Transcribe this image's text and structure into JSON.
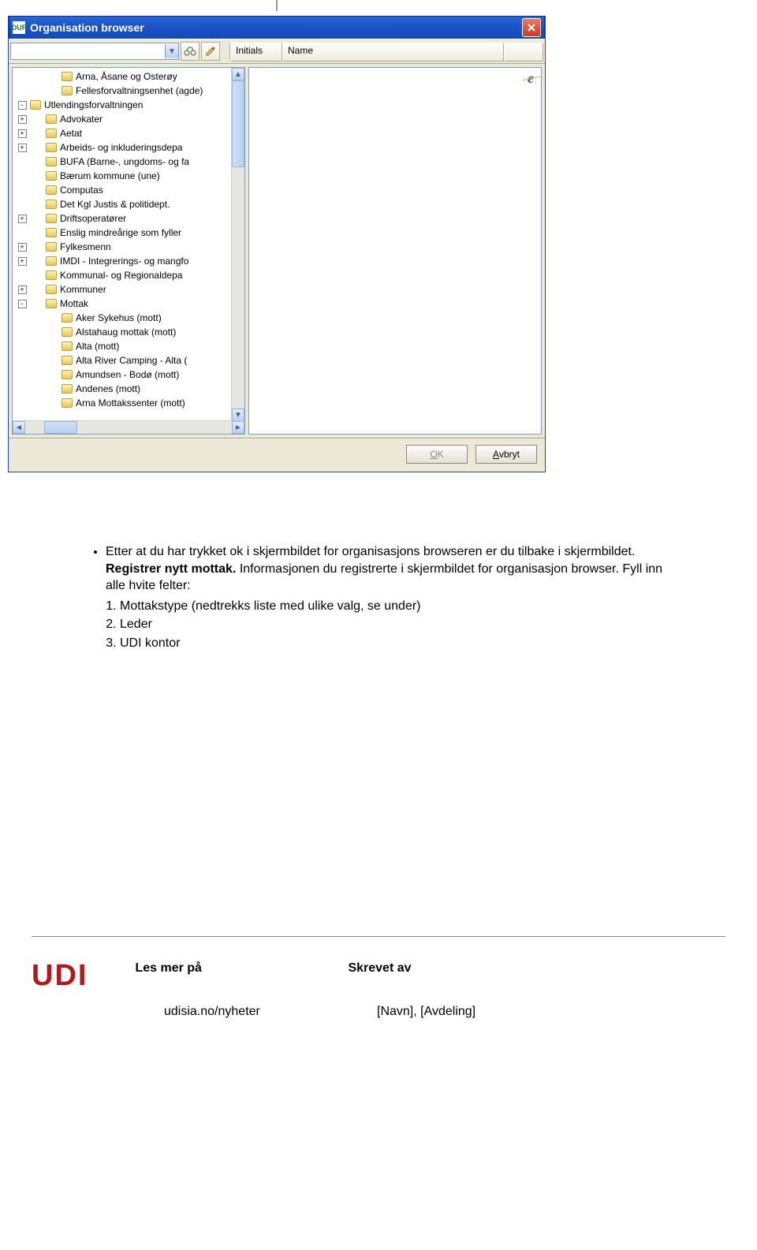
{
  "window": {
    "title": "Organisation browser",
    "app_icon_text": "DUF",
    "columns": {
      "initials": "Initials",
      "name": "Name"
    },
    "buttons": {
      "ok_letter": "O",
      "ok_rest": "K",
      "cancel_letter": "A",
      "cancel_rest": "vbryt"
    },
    "tree": [
      {
        "indent": 2,
        "pm": "",
        "label": "Arna, Åsane og Osterøy"
      },
      {
        "indent": 2,
        "pm": "",
        "label": "Fellesforvaltningsenhet (agde)"
      },
      {
        "indent": 0,
        "pm": "-",
        "label": "Utlendingsforvaltningen"
      },
      {
        "indent": 1,
        "pm": "+",
        "label": "Advokater"
      },
      {
        "indent": 1,
        "pm": "+",
        "label": "Aetat"
      },
      {
        "indent": 1,
        "pm": "+",
        "label": "Arbeids- og inkluderingsdepa"
      },
      {
        "indent": 1,
        "pm": "",
        "label": "BUFA (Barne-, ungdoms- og fa"
      },
      {
        "indent": 1,
        "pm": "",
        "label": "Bærum kommune (une)"
      },
      {
        "indent": 1,
        "pm": "",
        "label": "Computas"
      },
      {
        "indent": 1,
        "pm": "",
        "label": "Det Kgl Justis & politidept."
      },
      {
        "indent": 1,
        "pm": "+",
        "label": "Driftsoperatører"
      },
      {
        "indent": 1,
        "pm": "",
        "label": "Enslig mindreårige som fyller"
      },
      {
        "indent": 1,
        "pm": "+",
        "label": "Fylkesmenn"
      },
      {
        "indent": 1,
        "pm": "+",
        "label": "IMDI - Integrerings- og mangfo"
      },
      {
        "indent": 1,
        "pm": "",
        "label": "Kommunal- og Regionaldepa"
      },
      {
        "indent": 1,
        "pm": "+",
        "label": "Kommuner"
      },
      {
        "indent": 1,
        "pm": "-",
        "label": "Mottak"
      },
      {
        "indent": 2,
        "pm": "",
        "label": "Aker Sykehus (mott)"
      },
      {
        "indent": 2,
        "pm": "",
        "label": "Alstahaug mottak (mott)"
      },
      {
        "indent": 2,
        "pm": "",
        "label": "Alta (mott)"
      },
      {
        "indent": 2,
        "pm": "",
        "label": "Alta River Camping - Alta ("
      },
      {
        "indent": 2,
        "pm": "",
        "label": "Amundsen - Bodø (mott)"
      },
      {
        "indent": 2,
        "pm": "",
        "label": "Andenes (mott)"
      },
      {
        "indent": 2,
        "pm": "",
        "label": "Arna Mottakssenter (mott)"
      }
    ]
  },
  "doc": {
    "p1a": "Etter at du har trykket ok i skjermbildet for organisasjons browseren er du tilbake i skjermbildet. ",
    "p1b": "Registrer nytt mottak.",
    "p1c": " Informasjonen du registrerte i skjermbildet for organisasjon browser. Fyll inn alle hvite felter:",
    "li1": "Mottakstype (nedtrekks liste med ulike valg, se under)",
    "li2": "Leder",
    "li3": "UDI kontor"
  },
  "footer": {
    "logo": "UDI",
    "readmore_label": "Les mer på",
    "writtenby_label": "Skrevet av",
    "readmore_value": "udisia.no/nyheter",
    "writtenby_value": "[Navn], [Avdeling]"
  }
}
